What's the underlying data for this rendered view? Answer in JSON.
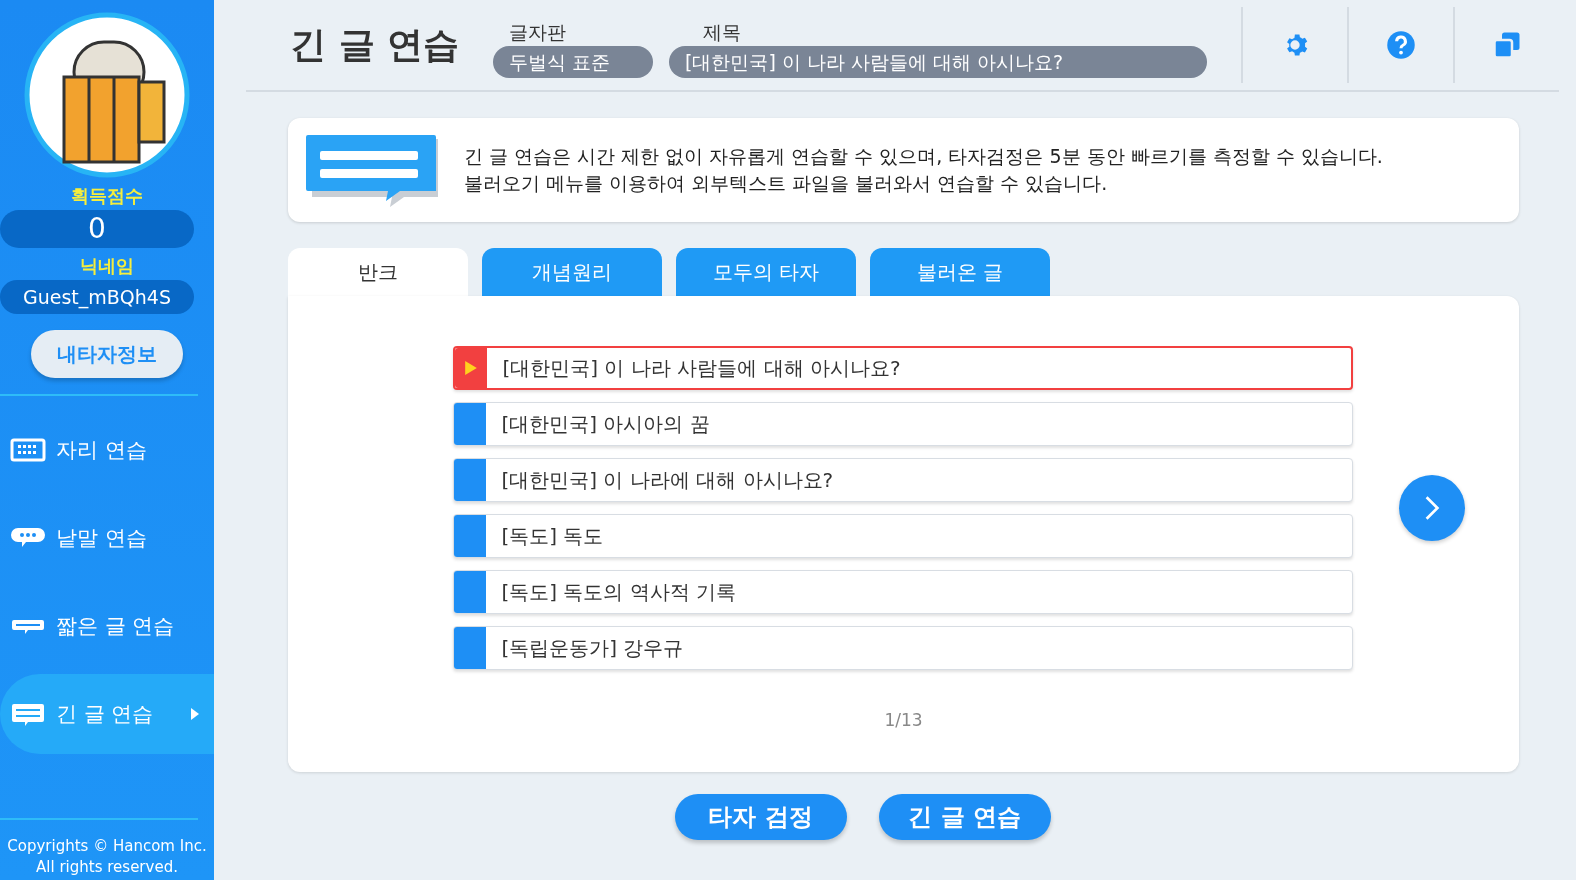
{
  "sidebar": {
    "score_label": "획득점수",
    "score": "0",
    "nickname_label": "닉네임",
    "nickname": "Guest_mBQh4S",
    "profile_button": "내타자정보",
    "menu": [
      {
        "label": "자리 연습",
        "kind": "keyboard",
        "selected": false
      },
      {
        "label": "낱말 연습",
        "kind": "chat",
        "selected": false
      },
      {
        "label": "짧은 글 연습",
        "kind": "short",
        "selected": false
      },
      {
        "label": "긴 글 연습",
        "kind": "long",
        "selected": true
      }
    ],
    "copyright": [
      "Copyrights © Hancom Inc.",
      "All rights reserved."
    ]
  },
  "header": {
    "title": "긴 글 연습",
    "keyboard_label": "글자판",
    "keyboard": "두벌식 표준",
    "subject_label": "제목",
    "subject": "[대한민국] 이 나라 사람들에 대해 아시나요?"
  },
  "info": [
    "긴 글 연습은 시간 제한 없이 자유롭게 연습할 수 있으며, 타자검정은 5분 동안 빠르기를 측정할 수 있습니다.",
    "불러오기 메뉴를 이용하여 외부텍스트 파일을 불러와서 연습할 수 있습니다."
  ],
  "tabs": [
    {
      "label": "반크",
      "selected": true
    },
    {
      "label": "개념원리",
      "selected": false
    },
    {
      "label": "모두의 타자",
      "selected": false
    },
    {
      "label": "불러온 글",
      "selected": false
    }
  ],
  "items": [
    {
      "title": "[대한민국] 이 나라 사람들에 대해 아시나요?",
      "selected": true
    },
    {
      "title": "[대한민국] 아시아의 꿈",
      "selected": false
    },
    {
      "title": "[대한민국] 이 나라에 대해 아시나요?",
      "selected": false
    },
    {
      "title": "[독도] 독도",
      "selected": false
    },
    {
      "title": "[독도] 독도의 역사적 기록",
      "selected": false
    },
    {
      "title": "[독립운동가] 강우규",
      "selected": false
    }
  ],
  "page": "1/13",
  "buttons": [
    "타자 검정",
    "긴 글 연습"
  ]
}
